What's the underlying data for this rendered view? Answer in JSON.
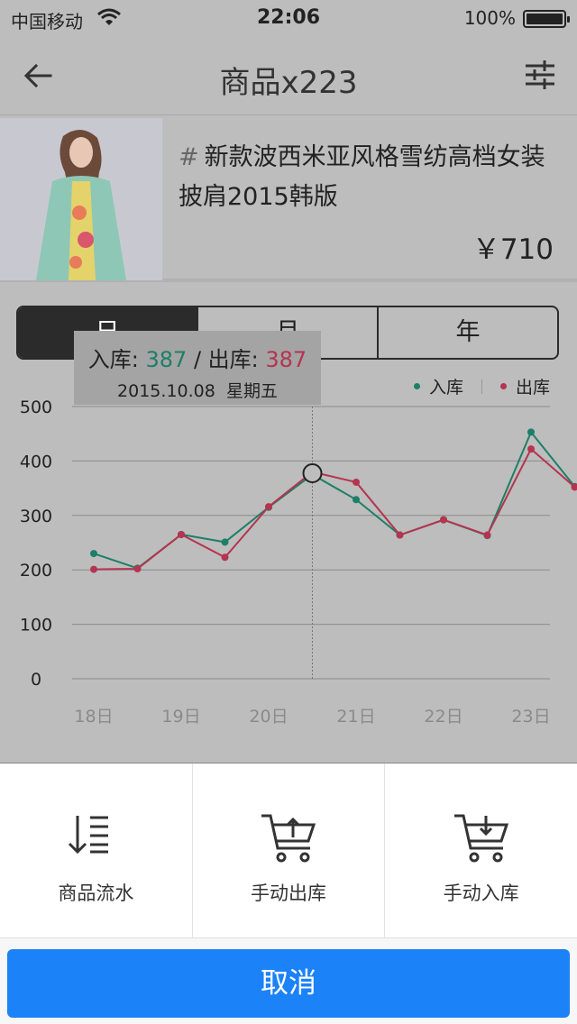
{
  "status_bar": {
    "carrier": "中国移动",
    "time": "22:06",
    "battery": "100%"
  },
  "nav": {
    "title": "商品x223"
  },
  "product": {
    "hash": "#",
    "name": "新款波西米亚风格雪纺高档女装披肩2015韩版",
    "price": "￥710"
  },
  "segments": [
    "日",
    "月",
    "年"
  ],
  "tooltip": {
    "in_label": "入库: ",
    "in_value": "387",
    "separator": " / ",
    "out_label": "出库: ",
    "out_value": "387",
    "date": "2015.10.08",
    "weekday": "星期五"
  },
  "legend": {
    "in": "入库",
    "out": "出库"
  },
  "colors": {
    "in": "#1d7f66",
    "out": "#b5344f",
    "cancel": "#1c82f7"
  },
  "chart_data": {
    "type": "line",
    "x": [
      0,
      0.5,
      1,
      1.5,
      2,
      2.5,
      3,
      3.5,
      4,
      4.5,
      5,
      5.5,
      5.75
    ],
    "categories": [
      "18日",
      "19日",
      "20日",
      "21日",
      "22日",
      "23日"
    ],
    "series": [
      {
        "name": "入库",
        "values": [
          230,
          203,
          265,
          251,
          315,
          375,
          329,
          264,
          292,
          263,
          453,
          353,
          352
        ]
      },
      {
        "name": "出库",
        "values": [
          201,
          202,
          265,
          223,
          316,
          380,
          361,
          264,
          292,
          264,
          422,
          352,
          352
        ]
      }
    ],
    "yticks": [
      0,
      100,
      200,
      300,
      400,
      500
    ],
    "ylim": [
      0,
      500
    ],
    "grid": true,
    "highlight_x": 2.5,
    "legend_position": "top-right"
  },
  "actions": [
    {
      "label": "商品流水",
      "icon": "sort-list-icon"
    },
    {
      "label": "手动出库",
      "icon": "cart-out-icon"
    },
    {
      "label": "手动入库",
      "icon": "cart-in-icon"
    }
  ],
  "cancel_label": "取消"
}
